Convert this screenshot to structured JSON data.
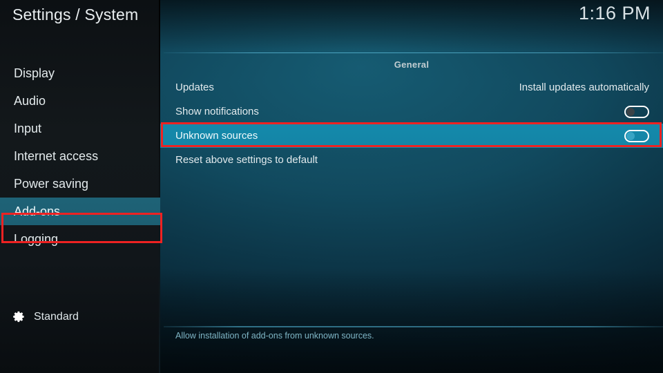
{
  "header": {
    "title": "Settings / System",
    "clock": "1:16 PM"
  },
  "sidebar": {
    "items": [
      {
        "label": "Display",
        "selected": false
      },
      {
        "label": "Audio",
        "selected": false
      },
      {
        "label": "Input",
        "selected": false
      },
      {
        "label": "Internet access",
        "selected": false
      },
      {
        "label": "Power saving",
        "selected": false
      },
      {
        "label": "Add-ons",
        "selected": true
      },
      {
        "label": "Logging",
        "selected": false
      }
    ],
    "profile": {
      "icon": "gear-icon",
      "label": "Standard"
    }
  },
  "main": {
    "group_title": "General",
    "rows": [
      {
        "label": "Updates",
        "value": "Install updates automatically",
        "control": "text",
        "selected": false
      },
      {
        "label": "Show notifications",
        "value": "",
        "control": "toggle",
        "toggle_on": false,
        "selected": false
      },
      {
        "label": "Unknown sources",
        "value": "",
        "control": "toggle",
        "toggle_on": false,
        "selected": true
      },
      {
        "label": "Reset above settings to default",
        "value": "",
        "control": "none",
        "selected": false
      }
    ],
    "help_text": "Allow installation of add-ons from unknown sources."
  },
  "annotations": {
    "color": "#ee2222",
    "boxes": [
      {
        "name": "addons-highlight",
        "target": "sidebar-item-add-ons"
      },
      {
        "name": "unknown-sources-highlight",
        "target": "row-unknown-sources"
      }
    ]
  },
  "colors": {
    "sidebar_bg": "#12171a",
    "content_bg": "#115066",
    "selected_row": "#1387a8",
    "selected_menu": "#1d6276",
    "annotation_red": "#ee2222",
    "help_text": "#7fb6c6"
  }
}
